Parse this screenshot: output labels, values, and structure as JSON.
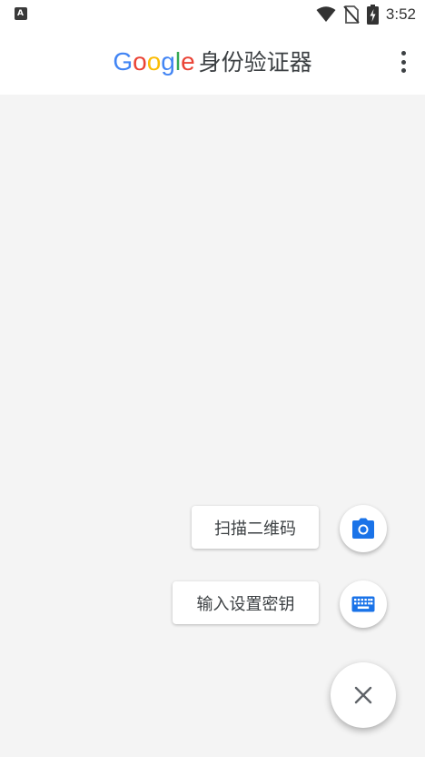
{
  "status_bar": {
    "time": "3:52",
    "notification_badge": "A",
    "icons": [
      "notification-a-icon",
      "wifi-icon",
      "no-sim-icon",
      "battery-charging-icon"
    ]
  },
  "app_bar": {
    "brand_letters": [
      "G",
      "o",
      "o",
      "g",
      "l",
      "e"
    ],
    "brand_colors": [
      "#4285F4",
      "#EA4335",
      "#FBBC05",
      "#4285F4",
      "#34A853",
      "#EA4335"
    ],
    "title": "身份验证器",
    "menu_icon": "more-vert-icon"
  },
  "speed_dial": {
    "scan_label": "扫描二维码",
    "scan_icon": "camera-icon",
    "key_label": "输入设置密钥",
    "key_icon": "keyboard-icon",
    "close_icon": "close-icon",
    "accent_color": "#1A73E8"
  }
}
